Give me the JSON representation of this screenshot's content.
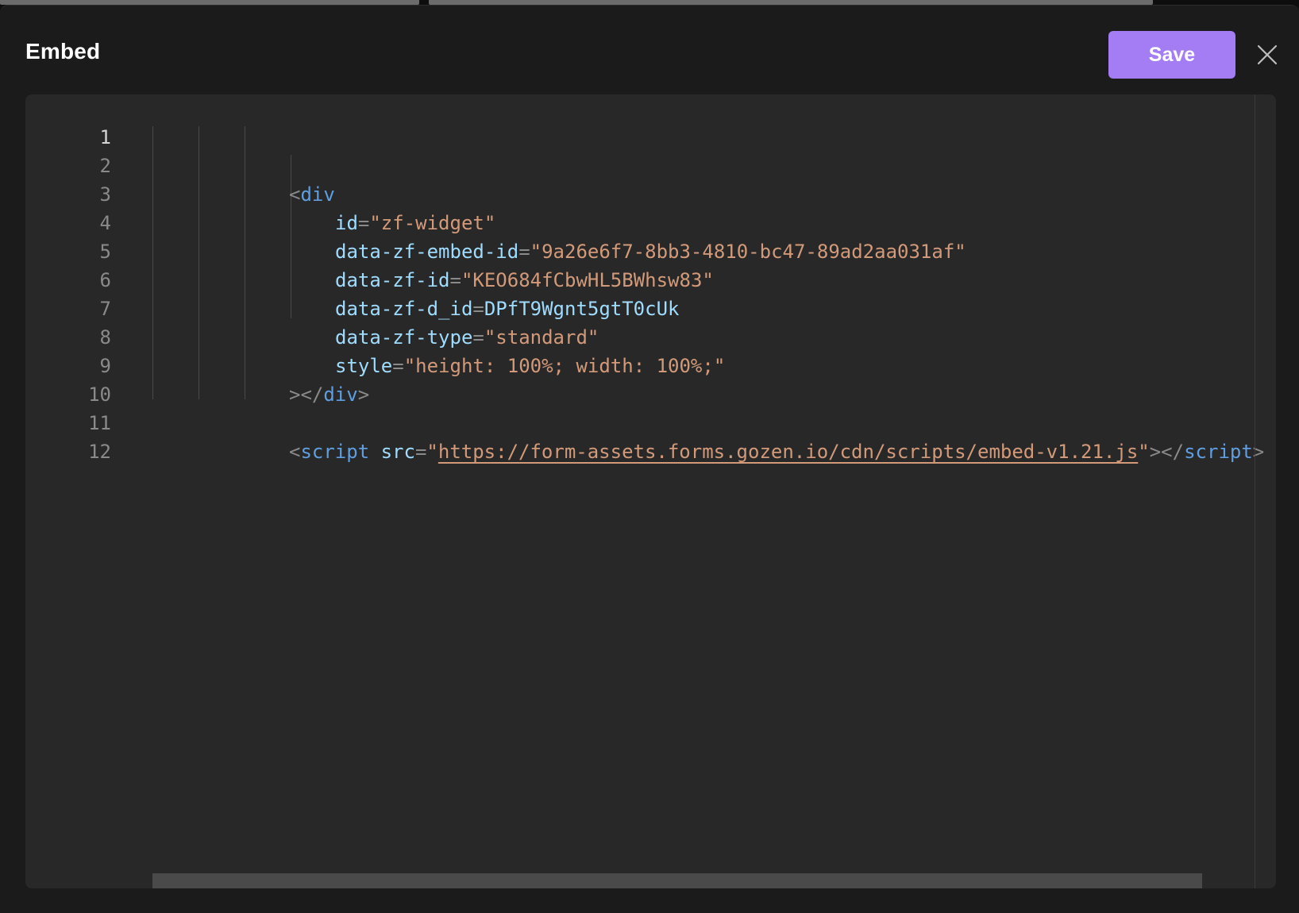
{
  "dialog": {
    "title": "Embed",
    "save_label": "Save"
  },
  "editor": {
    "line_numbers": [
      "1",
      "2",
      "3",
      "4",
      "5",
      "6",
      "7",
      "8",
      "9",
      "10",
      "11",
      "12"
    ],
    "lines": {
      "l2": {
        "open": "<",
        "tag": "div"
      },
      "l3": {
        "attr": "id",
        "eq": "=",
        "val": "\"zf-widget\""
      },
      "l4": {
        "attr": "data-zf-embed-id",
        "eq": "=",
        "val": "\"9a26e6f7-8bb3-4810-bc47-89ad2aa031af\""
      },
      "l5": {
        "attr": "data-zf-id",
        "eq": "=",
        "val": "\"KEO684fCbwHL5BWhsw83\""
      },
      "l6": {
        "attr": "data-zf-d_id",
        "eq": "=",
        "val": "DPfT9Wgnt5gtT0cUk"
      },
      "l7": {
        "attr": "data-zf-type",
        "eq": "=",
        "val": "\"standard\""
      },
      "l8": {
        "attr": "style",
        "eq": "=",
        "val": "\"height: 100%; width: 100%;\""
      },
      "l9": {
        "close_a": "></",
        "tag": "div",
        "close_b": ">"
      },
      "l11": {
        "open": "<",
        "tag": "script",
        "space": " ",
        "attr": "src",
        "eq": "=",
        "quote_open": "\"",
        "url": "https://form-assets.forms.gozen.io/cdn/scripts/embed-v1.21.js",
        "quote_close": "\"",
        "end_open": "></",
        "end_tag": "script",
        "end_close": ">"
      }
    }
  },
  "colors": {
    "accent": "#a47cf3",
    "background": "#1b1b1b",
    "editor_background": "#282828",
    "tag": "#5f9ee0",
    "attribute": "#9fdcfe",
    "string": "#d39a7a"
  },
  "icons": {
    "close": "close-icon"
  }
}
